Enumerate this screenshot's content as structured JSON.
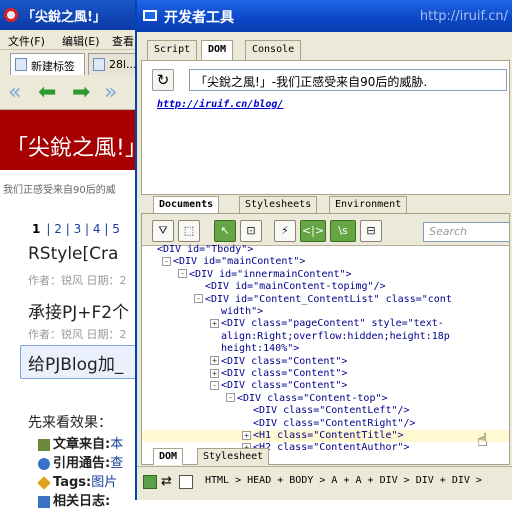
{
  "browser": {
    "window_title": "「尖銳之風!」",
    "menu": [
      "文件(F)",
      "编辑(E)",
      "查看"
    ],
    "tabs": [
      "新建标签",
      "28l..."
    ],
    "banner": "「尖銳之風!」",
    "subtitle": "我们正感受来自90后的威",
    "pages": [
      "1",
      "|",
      "2",
      "|",
      "3",
      "|",
      "4",
      "|",
      "5"
    ],
    "articles": [
      {
        "title": "RStyle[Cra",
        "meta": "作者：锐风  日期：2"
      },
      {
        "title": "承接PJ+F2个",
        "meta": "作者：锐风  日期：2"
      },
      {
        "title": "给PJBlog加_",
        "meta": ""
      }
    ],
    "section": "先来看效果：",
    "list": [
      {
        "label": "文章来自:",
        "value": "本"
      },
      {
        "label": "引用通告:",
        "value": "查"
      },
      {
        "label": "Tags:",
        "value": "图片"
      },
      {
        "label": "相关日志:",
        "value": ""
      }
    ]
  },
  "devtools": {
    "title": "开发者工具",
    "url_watermark": "http://iruif.cn/",
    "tabs": [
      "Script",
      "DOM",
      "Console"
    ],
    "active_tab": "DOM",
    "address": "「尖銳之風!」-我们正感受来自90后的威胁.",
    "page_url": "http://iruif.cn/blog/",
    "subtabs": [
      "Documents",
      "Stylesheets",
      "Environment"
    ],
    "toolbar": [
      "⛛",
      "⬚",
      "↖",
      "⊡",
      "⚡",
      "<|>",
      "\\s",
      "⊟"
    ],
    "search_placeholder": "Search",
    "tree": [
      {
        "indent": 0,
        "pm": "",
        "tag": "<DIV id=\"Tbody\">",
        "partial": true
      },
      {
        "indent": 1,
        "pm": "-",
        "tag": "<DIV id=\"mainContent\">"
      },
      {
        "indent": 2,
        "pm": "-",
        "tag": "<DIV id=\"innermainContent\">"
      },
      {
        "indent": 3,
        "pm": "",
        "tag": "<DIV id=\"mainContent-topimg\"/>"
      },
      {
        "indent": 3,
        "pm": "-",
        "tag": "<DIV id=\"Content_ContentList\" class=\"cont"
      },
      {
        "indent": 4,
        "pm": "",
        "tag": "width\">"
      },
      {
        "indent": 4,
        "pm": "+",
        "tag": "<DIV class=\"pageContent\" style=\"text-"
      },
      {
        "indent": 4,
        "pm": "",
        "tag": "align:Right;overflow:hidden;height:18p"
      },
      {
        "indent": 4,
        "pm": "",
        "tag": "height:140%\">"
      },
      {
        "indent": 4,
        "pm": "+",
        "tag": "<DIV class=\"Content\">"
      },
      {
        "indent": 4,
        "pm": "+",
        "tag": "<DIV class=\"Content\">"
      },
      {
        "indent": 4,
        "pm": "-",
        "tag": "<DIV class=\"Content\">"
      },
      {
        "indent": 5,
        "pm": "-",
        "tag": "<DIV class=\"Content-top\">"
      },
      {
        "indent": 6,
        "pm": "",
        "tag": "<DIV class=\"ContentLeft\"/>"
      },
      {
        "indent": 6,
        "pm": "",
        "tag": "<DIV class=\"ContentRight\"/>"
      },
      {
        "indent": 6,
        "pm": "+",
        "tag": "<H1 class=\"ContentTitle\">",
        "selected": true
      },
      {
        "indent": 6,
        "pm": "+",
        "tag": "<H2 class=\"ContentAuthor\">"
      }
    ],
    "bottom_tabs": [
      "DOM",
      "Stylesheet"
    ],
    "breadcrumb": "HTML > HEAD + BODY > A + A + DIV > DIV + DIV >"
  }
}
